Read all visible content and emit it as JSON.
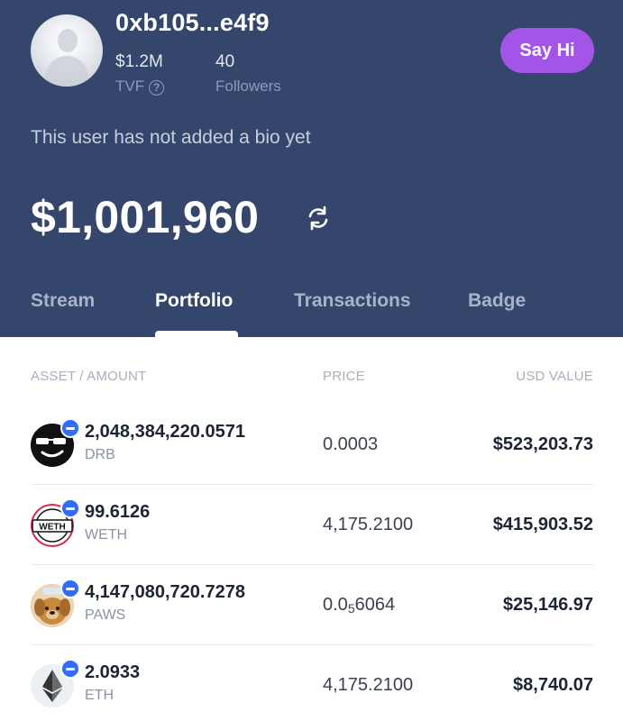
{
  "profile": {
    "username": "0xb105...e4f9",
    "tvf_value": "$1.2M",
    "tvf_label": "TVF",
    "followers_value": "40",
    "followers_label": "Followers",
    "say_hi_label": "Say Hi",
    "bio": "This user has not added a bio yet",
    "balance": "$1,001,960"
  },
  "tabs": [
    "Stream",
    "Portfolio",
    "Transactions",
    "Badge"
  ],
  "active_tab": "Portfolio",
  "table": {
    "headers": [
      "ASSET / AMOUNT",
      "PRICE",
      "USD VALUE"
    ],
    "rows": [
      {
        "amount": "2,048,384,220.0571",
        "symbol": "DRB",
        "price_main": "0.0003",
        "price_sub": "",
        "price_rest": "",
        "usd": "$523,203.73",
        "icon": "drb-token-icon"
      },
      {
        "amount": "99.6126",
        "symbol": "WETH",
        "price_main": "4,175.2100",
        "price_sub": "",
        "price_rest": "",
        "usd": "$415,903.52",
        "icon": "weth-token-icon"
      },
      {
        "amount": "4,147,080,720.7278",
        "symbol": "PAWS",
        "price_main": "0.0",
        "price_sub": "5",
        "price_rest": "6064",
        "usd": "$25,146.97",
        "icon": "paws-token-icon"
      },
      {
        "amount": "2.0933",
        "symbol": "ETH",
        "price_main": "4,175.2100",
        "price_sub": "",
        "price_rest": "",
        "usd": "$8,740.07",
        "icon": "eth-token-icon"
      }
    ]
  },
  "colors": {
    "header_bg": "#34466c",
    "accent_purple": "#a454e6",
    "badge_blue": "#2f6cff"
  }
}
